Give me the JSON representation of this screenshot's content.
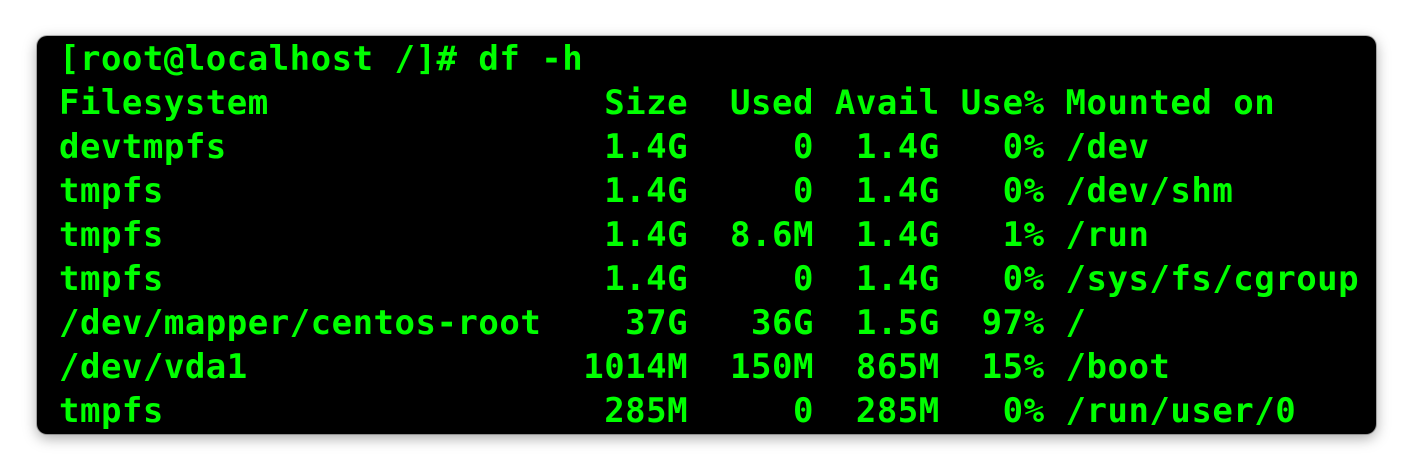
{
  "terminal": {
    "prompt": "[root@localhost /]# df -h",
    "lines": [
      "Filesystem                Size  Used Avail Use% Mounted on",
      "devtmpfs                  1.4G     0  1.4G   0% /dev",
      "tmpfs                     1.4G     0  1.4G   0% /dev/shm",
      "tmpfs                     1.4G  8.6M  1.4G   1% /run",
      "tmpfs                     1.4G     0  1.4G   0% /sys/fs/cgroup",
      "/dev/mapper/centos-root    37G   36G  1.5G  97% /",
      "/dev/vda1                1014M  150M  865M  15% /boot",
      "tmpfs                     285M     0  285M   0% /run/user/0"
    ],
    "colors": {
      "text": "#00ff00",
      "background": "#000000"
    }
  }
}
